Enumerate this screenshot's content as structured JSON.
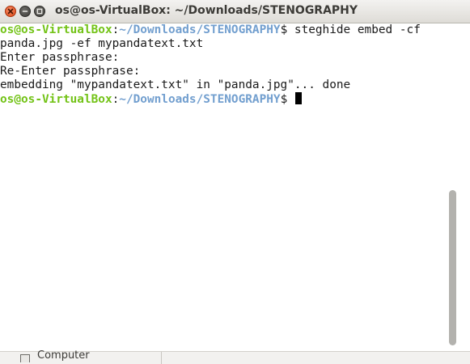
{
  "window": {
    "title": "os@os-VirtualBox: ~/Downloads/STENOGRAPHY"
  },
  "terminal": {
    "lines": [
      {
        "prompt_user": "os@os-VirtualBox",
        "prompt_sep": ":",
        "prompt_path": "~/Downloads/STENOGRAPHY",
        "prompt_end": "$ ",
        "command": "steghide embed -cf"
      },
      {
        "text": "panda.jpg -ef mypandatext.txt"
      },
      {
        "text": "Enter passphrase:"
      },
      {
        "text": "Re-Enter passphrase:"
      },
      {
        "text": "embedding \"mypandatext.txt\" in \"panda.jpg\"... done"
      },
      {
        "prompt_user": "os@os-VirtualBox",
        "prompt_sep": ":",
        "prompt_path": "~/Downloads/STENOGRAPHY",
        "prompt_end": "$ ",
        "command": ""
      }
    ]
  },
  "background_window": {
    "sidebar_item_label": "Computer"
  },
  "colors": {
    "prompt_user": "#73c317",
    "prompt_path": "#729fcf",
    "close_button": "#df4b16"
  },
  "icons": [
    "close-icon",
    "minimize-icon",
    "maximize-icon",
    "computer-icon"
  ]
}
